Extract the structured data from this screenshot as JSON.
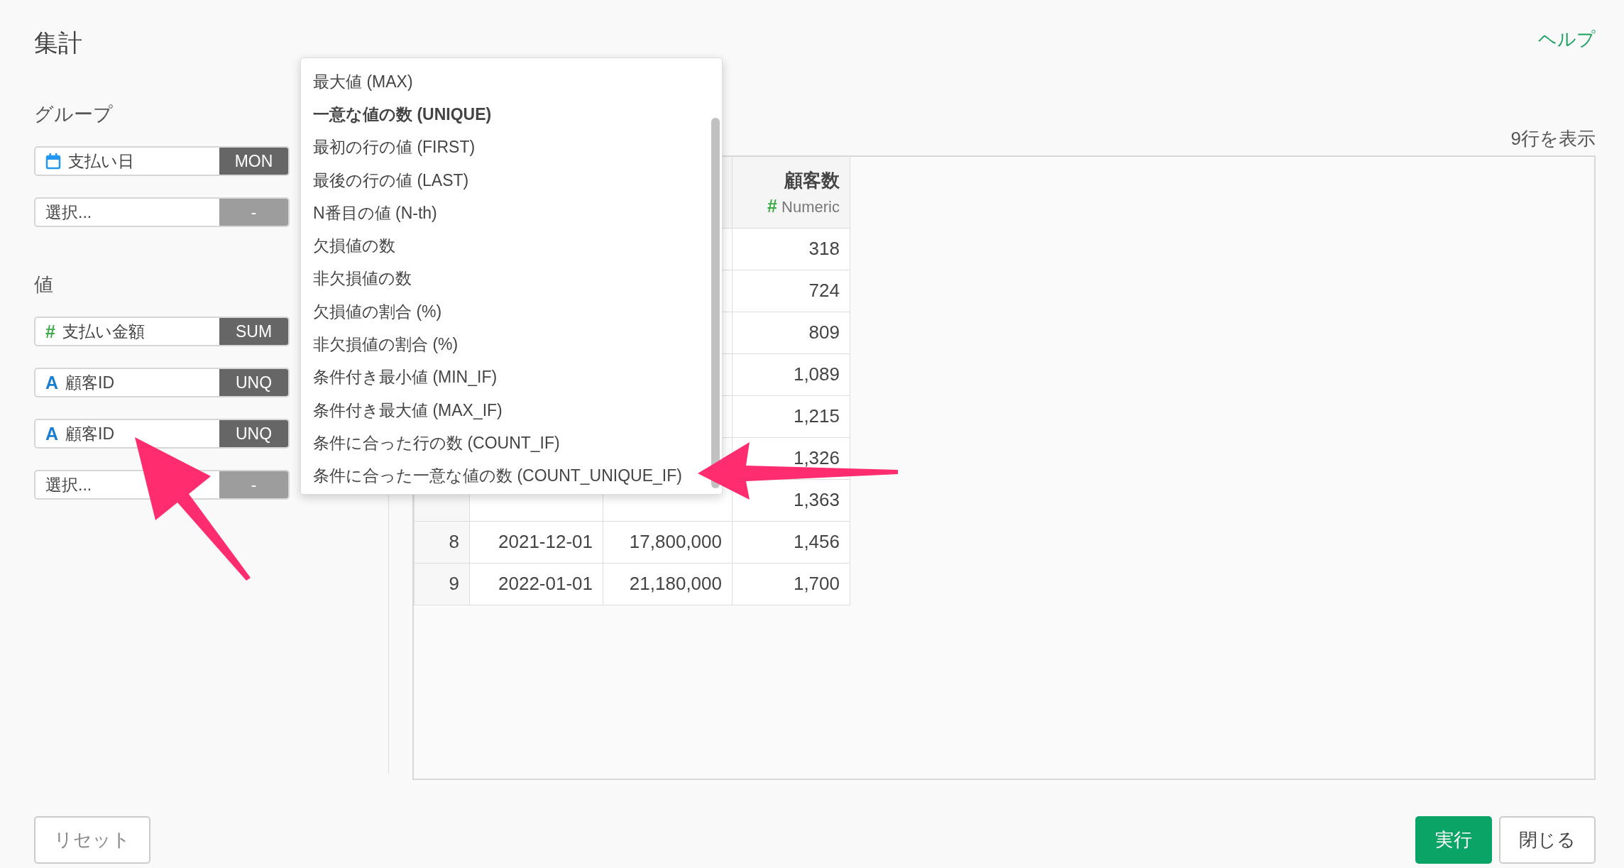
{
  "title": "集計",
  "help_link": "ヘルプ",
  "group": {
    "label": "グループ",
    "rows": [
      {
        "kind": "date",
        "label": "支払い日",
        "func": "MON",
        "assigned": true
      },
      {
        "placeholder": "選択...",
        "func": "-",
        "assigned": false
      }
    ]
  },
  "values": {
    "label": "値",
    "rows": [
      {
        "kind": "number",
        "type_mark": "#",
        "label": "支払い金額",
        "func": "SUM",
        "assigned": true
      },
      {
        "kind": "text",
        "type_mark": "A",
        "label": "顧客ID",
        "func": "UNQ",
        "assigned": true
      },
      {
        "kind": "text",
        "type_mark": "A",
        "label": "顧客ID",
        "func": "UNQ",
        "assigned": true
      },
      {
        "placeholder": "選択...",
        "func": "-",
        "assigned": false
      }
    ]
  },
  "row_count": "9行を表示",
  "table": {
    "columns": [
      {
        "title": "顧客数",
        "type_mark": "#",
        "type": "Numeric"
      }
    ],
    "rows": [
      {
        "count": "318"
      },
      {
        "count": "724"
      },
      {
        "count": "809"
      },
      {
        "count": "1,089"
      },
      {
        "count": "1,215"
      },
      {
        "count": "1,326"
      },
      {
        "count": "1,363"
      },
      {
        "number": "8",
        "date": "2021-12-01",
        "amount": "17,800,000",
        "count": "1,456"
      },
      {
        "number": "9",
        "date": "2022-01-01",
        "amount": "21,180,000",
        "count": "1,700"
      }
    ]
  },
  "dropdown": {
    "items": [
      {
        "label": "最大値 (MAX)",
        "selected": false
      },
      {
        "label": "一意な値の数 (UNIQUE)",
        "selected": true
      },
      {
        "label": "最初の行の値 (FIRST)",
        "selected": false
      },
      {
        "label": "最後の行の値 (LAST)",
        "selected": false
      },
      {
        "label": "N番目の値 (N-th)",
        "selected": false
      },
      {
        "label": "欠損値の数",
        "selected": false
      },
      {
        "label": "非欠損値の数",
        "selected": false
      },
      {
        "label": "欠損値の割合 (%)",
        "selected": false
      },
      {
        "label": "非欠損値の割合 (%)",
        "selected": false
      },
      {
        "label": "条件付き最小値 (MIN_IF)",
        "selected": false
      },
      {
        "label": "条件付き最大値 (MAX_IF)",
        "selected": false
      },
      {
        "label": "条件に合った行の数 (COUNT_IF)",
        "selected": false
      },
      {
        "label": "条件に合った一意な値の数 (COUNT_UNIQUE_IF)",
        "selected": false
      }
    ]
  },
  "footer": {
    "reset": "リセット",
    "run": "実行",
    "close": "閉じる"
  }
}
